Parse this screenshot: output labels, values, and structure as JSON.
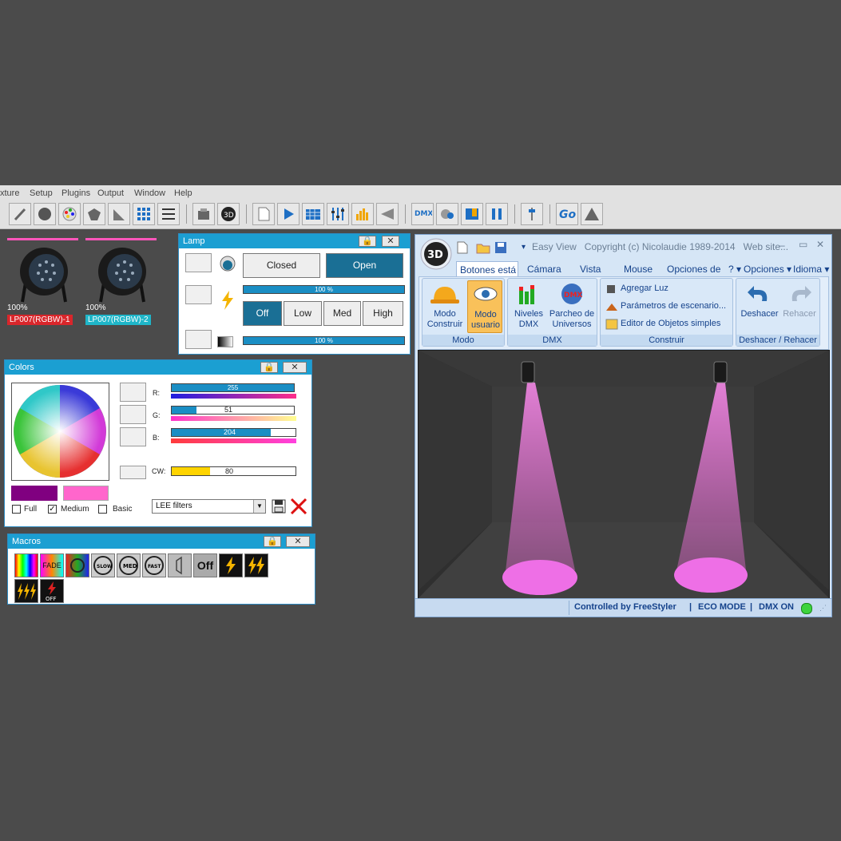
{
  "menu": [
    "xture",
    "Setup",
    "Plugins",
    "Output",
    "Window",
    "Help"
  ],
  "fixtures": [
    {
      "name": "LP007(RGBW)-1",
      "intensity": "100%",
      "label_color": "#d9262b"
    },
    {
      "name": "LP007(RGBW)-2",
      "intensity": "100%",
      "label_color": "#1fb6c9"
    }
  ],
  "lamp": {
    "title": "Lamp",
    "shutter": [
      "Closed",
      "Open"
    ],
    "strobe_value": "100 %",
    "modes": [
      "Off",
      "Low",
      "Med",
      "High"
    ],
    "dimmer_value": "100 %"
  },
  "colors": {
    "title": "Colors",
    "channels": [
      {
        "label": "R:",
        "value": "255",
        "fraction": 1.0,
        "grad": "#ff2e8a"
      },
      {
        "label": "G:",
        "value": "51",
        "fraction": 0.2,
        "grad": "#ff5fd0"
      },
      {
        "label": "B:",
        "value": "204",
        "fraction": 0.8,
        "grad": "#ff3b3b"
      }
    ],
    "cw": {
      "label": "CW:",
      "value": "80",
      "fraction": 0.31
    },
    "checks": [
      {
        "label": "Full",
        "checked": false
      },
      {
        "label": "Medium",
        "checked": true
      },
      {
        "label": "Basic",
        "checked": false
      }
    ],
    "filter": "LEE filters",
    "swatch_a": "#800080",
    "swatch_b": "#ff66cc"
  },
  "macros": {
    "title": "Macros",
    "items": [
      "rainbow",
      "FADE",
      "color-cycle",
      "SLOW",
      "MED",
      "FAST",
      "sound",
      "Off",
      "strobe-1",
      "strobe-2",
      "strobe-3",
      "OFF"
    ]
  },
  "easyview": {
    "title": "Easy View   Copyright (c) Nicolaudie 1989-2014   Web site...",
    "tabs": [
      "Botones está",
      "Cámara",
      "Vista",
      "Mouse",
      "Opciones de",
      "?",
      "Opciones",
      "Idioma"
    ],
    "modo": {
      "construir": "Modo\nConstruir",
      "usuario": "Modo\nusuario",
      "label": "Modo"
    },
    "dmx": {
      "niveles": "Niveles\nDMX",
      "parcheo": "Parcheo de\nUniversos",
      "label": "DMX"
    },
    "construir": {
      "items": [
        "Agregar Luz",
        "Parámetros de escenario...",
        "Editor de Objetos simples"
      ],
      "label": "Construir"
    },
    "undo": {
      "deshacer": "Deshacer",
      "rehacer": "Rehacer",
      "label": "Deshacer / Rehacer"
    },
    "status": [
      "Controlled by FreeStyler",
      "|",
      "ECO MODE",
      "|",
      "DMX ON"
    ]
  }
}
